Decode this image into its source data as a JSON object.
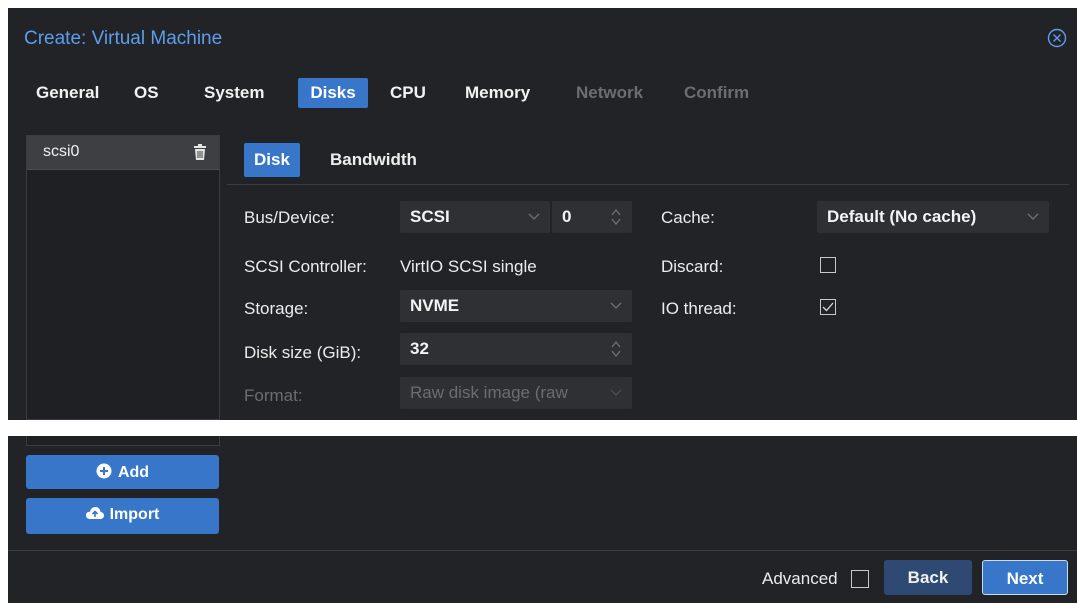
{
  "window": {
    "title": "Create: Virtual Machine"
  },
  "tabs": [
    {
      "label": "General",
      "state": "normal"
    },
    {
      "label": "OS",
      "state": "normal"
    },
    {
      "label": "System",
      "state": "normal"
    },
    {
      "label": "Disks",
      "state": "active"
    },
    {
      "label": "CPU",
      "state": "normal"
    },
    {
      "label": "Memory",
      "state": "normal"
    },
    {
      "label": "Network",
      "state": "disabled"
    },
    {
      "label": "Confirm",
      "state": "disabled"
    }
  ],
  "disk_list": {
    "items": [
      {
        "label": "scsi0",
        "selected": true
      }
    ],
    "add_label": "Add",
    "import_label": "Import"
  },
  "subtabs": {
    "disk": "Disk",
    "bandwidth": "Bandwidth"
  },
  "form": {
    "bus_device": {
      "label": "Bus/Device:",
      "bus": "SCSI",
      "device": "0"
    },
    "scsi_controller": {
      "label": "SCSI Controller:",
      "value": "VirtIO SCSI single"
    },
    "storage": {
      "label": "Storage:",
      "value": "NVME"
    },
    "disk_size": {
      "label": "Disk size (GiB):",
      "value": "32"
    },
    "format": {
      "label": "Format:",
      "value": "Raw disk image (raw"
    },
    "cache": {
      "label": "Cache:",
      "value": "Default (No cache)"
    },
    "discard": {
      "label": "Discard:",
      "checked": false
    },
    "io_thread": {
      "label": "IO thread:",
      "checked": true
    }
  },
  "footer": {
    "advanced_label": "Advanced",
    "advanced_checked": false,
    "back_label": "Back",
    "next_label": "Next"
  },
  "colors": {
    "background": "#222326",
    "accent": "#3776c9",
    "title": "#5c9ded",
    "field": "#2f3034",
    "disabled_text": "#6b6d71"
  },
  "icons": {
    "close": "close-circle-icon",
    "trash": "trash-icon",
    "add": "plus-circle-icon",
    "import": "cloud-upload-icon",
    "dropdown": "chevron-down-icon",
    "spinner": "spinner-arrows-icon"
  }
}
